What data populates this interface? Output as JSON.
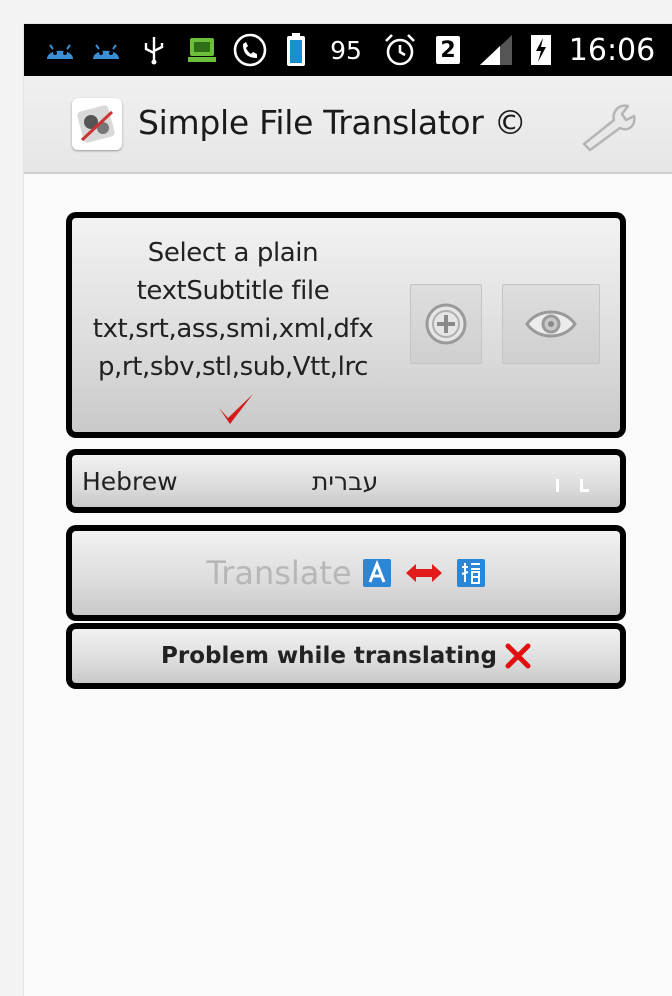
{
  "status_bar": {
    "battery_level": "95",
    "sim_slot": "2",
    "time": "16:06",
    "icons": [
      "android-icon",
      "android-icon",
      "usb-icon",
      "app-notification-icon",
      "phone-call-icon",
      "battery-icon",
      "alarm-icon",
      "sim-icon",
      "signal-icon",
      "charging-icon"
    ]
  },
  "action_bar": {
    "title": "Simple File Translator ©",
    "app_icon": "translator-app-icon",
    "settings_icon": "wrench-icon"
  },
  "file_card": {
    "line1": "Select a plain",
    "line2": "textSubtitle file",
    "line3": "txt,srt,ass,smi,xml,dfx",
    "line4": "p,rt,sbv,stl,sub,Vtt,lrc",
    "add_icon": "plus-circle-icon",
    "view_icon": "eye-icon",
    "check_icon": "checkmark-icon",
    "check_color": "#d21b1b"
  },
  "language": {
    "name": "Hebrew",
    "native": "עברית"
  },
  "translate": {
    "label": "Translate",
    "from_icon": "letter-a-icon",
    "arrow_icon": "double-arrow-icon",
    "to_icon": "cjk-character-icon",
    "accent": "#2b86d6",
    "arrow_color": "#e21b1b"
  },
  "status": {
    "message": "Problem while translating",
    "error_icon": "x-mark-icon",
    "error_color": "#e01010"
  }
}
